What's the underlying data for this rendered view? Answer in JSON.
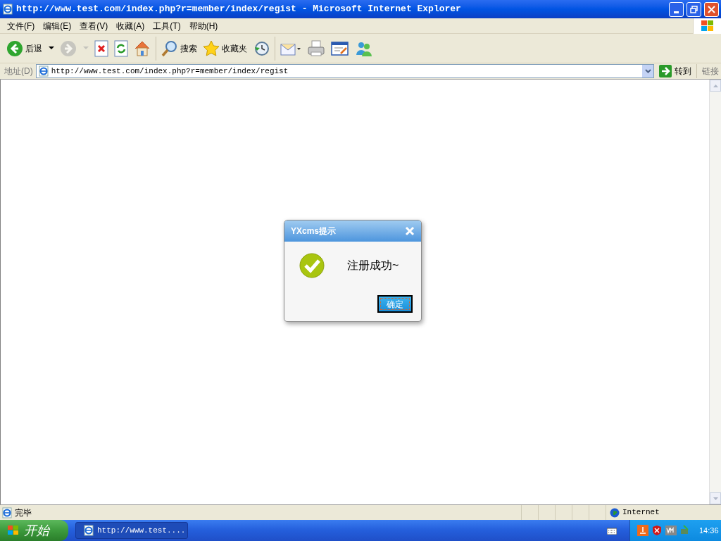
{
  "window": {
    "title": "http://www.test.com/index.php?r=member/index/regist - Microsoft Internet Explorer"
  },
  "menu": [
    "文件(F)",
    "编辑(E)",
    "查看(V)",
    "收藏(A)",
    "工具(T)",
    "帮助(H)"
  ],
  "toolbar": [
    {
      "kind": "back",
      "label": "后退",
      "disabled": false
    },
    {
      "kind": "forward",
      "disabled": true
    },
    {
      "kind": "stop",
      "disabled": false
    },
    {
      "kind": "refresh",
      "disabled": false
    },
    {
      "kind": "home",
      "disabled": false
    },
    {
      "kind": "search",
      "label": "搜索",
      "disabled": false
    },
    {
      "kind": "favorites",
      "label": "收藏夹",
      "disabled": false
    },
    {
      "kind": "history",
      "disabled": false
    },
    {
      "kind": "mail",
      "disabled": false
    },
    {
      "kind": "print",
      "disabled": false
    },
    {
      "kind": "edit",
      "disabled": false
    },
    {
      "kind": "messenger",
      "disabled": false
    }
  ],
  "address": {
    "label": "地址(D)",
    "value": "http://www.test.com/index.php?r=member/index/regist",
    "go": "转到",
    "links": "链接"
  },
  "dialog": {
    "title": "YXcms提示",
    "message": "注册成功~",
    "button": "确定"
  },
  "status_bar": {
    "text": "完毕",
    "zone": "Internet"
  },
  "taskbar": {
    "start": "开始",
    "tasks": [
      {
        "label": "http://www.test....",
        "selected": true
      }
    ],
    "clock": "14:36"
  }
}
